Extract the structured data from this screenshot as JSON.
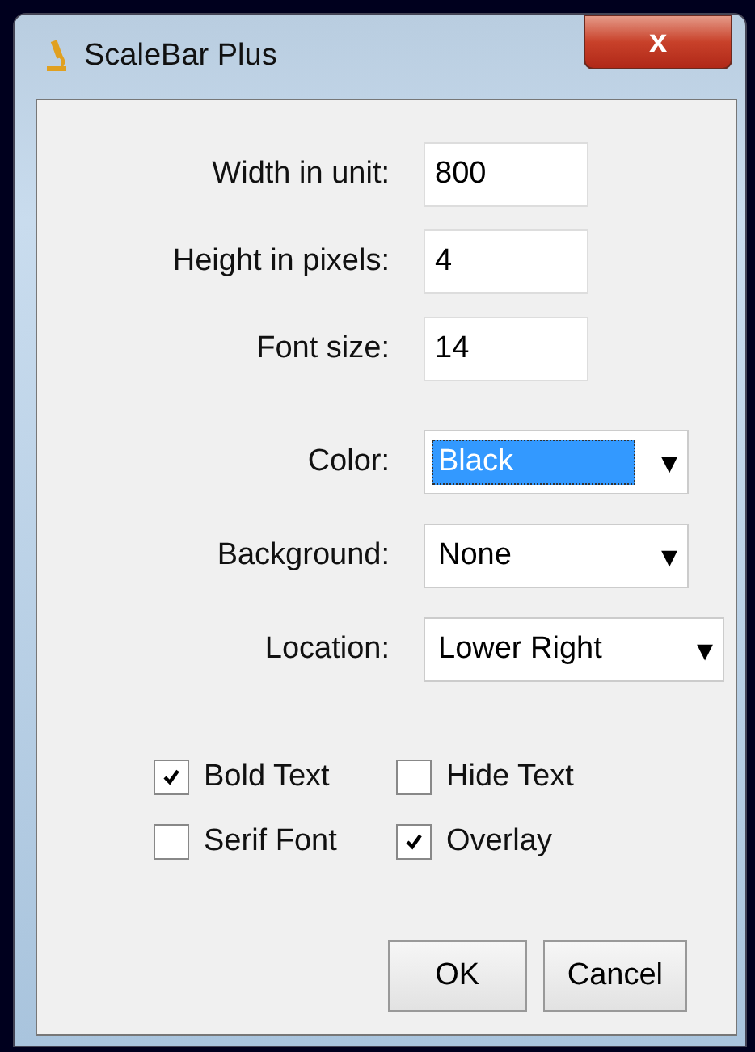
{
  "window": {
    "title": "ScaleBar Plus",
    "close": "x"
  },
  "fields": [
    {
      "label": "Width in unit:",
      "value": "800"
    },
    {
      "label": "Height in pixels:",
      "value": "4"
    },
    {
      "label": "Font size:",
      "value": "14"
    }
  ],
  "choices": [
    {
      "label": "Color:",
      "value": "Black",
      "focused": true,
      "arrow": "▾"
    },
    {
      "label": "Background:",
      "value": "None",
      "focused": false,
      "arrow": "▾"
    },
    {
      "label": "Location:",
      "value": "Lower Right",
      "focused": false,
      "arrow": "▾"
    }
  ],
  "checkboxes": [
    {
      "label": "Bold Text",
      "checked": true
    },
    {
      "label": "Hide Text",
      "checked": false
    },
    {
      "label": "Serif Font",
      "checked": false
    },
    {
      "label": "Overlay",
      "checked": true
    }
  ],
  "buttons": [
    "OK",
    "Cancel"
  ]
}
